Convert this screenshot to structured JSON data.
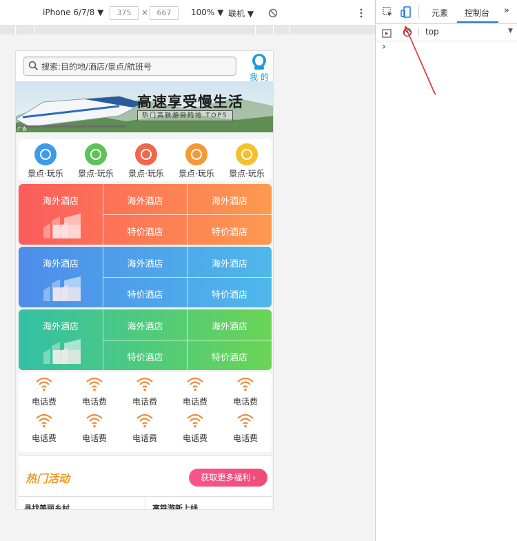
{
  "device_toolbar": {
    "device": "iPhone 6/7/8 ▼",
    "width": "375",
    "times": "×",
    "height": "667",
    "zoom": "100% ▼",
    "network": "联机 ▼"
  },
  "devtools": {
    "tabs": [
      "元素",
      "控制台"
    ],
    "active_tab": "控制台",
    "context": "top",
    "prompt": "›",
    "more": "»"
  },
  "search": {
    "placeholder": "搜索:目的地/酒店/景点/航班号",
    "my_label": "我 的"
  },
  "banner": {
    "title": "高速享受慢生活",
    "subtitle": "热门高铁游目的地 TOP5",
    "ad": "广告"
  },
  "icons": [
    {
      "label": "景点·玩乐",
      "color": "#3d9be9",
      "icon": "temple-icon"
    },
    {
      "label": "景点·玩乐",
      "color": "#5cc456",
      "icon": "mountain-icon"
    },
    {
      "label": "景点·玩乐",
      "color": "#f0674b",
      "icon": "circle-icon"
    },
    {
      "label": "景点·玩乐",
      "color": "#f29a35",
      "icon": "ferris-wheel-icon"
    },
    {
      "label": "景点·玩乐",
      "color": "#f5c030",
      "icon": "location-icon"
    }
  ],
  "hotel_blocks": [
    {
      "main": "海外酒店",
      "top1": "海外酒店",
      "top2": "海外酒店",
      "bottom1": "特价酒店",
      "bottom2": "特价酒店",
      "color_from": "#fb5c5c",
      "color_to": "#fd9a4f"
    },
    {
      "main": "海外酒店",
      "top1": "海外酒店",
      "top2": "海外酒店",
      "bottom1": "特价酒店",
      "bottom2": "特价酒店",
      "color_from": "#4e8dea",
      "color_to": "#4eb8ea"
    },
    {
      "main": "海外酒店",
      "top1": "海外酒店",
      "top2": "海外酒店",
      "bottom1": "特价酒店",
      "bottom2": "特价酒店",
      "color_from": "#34c0a5",
      "color_to": "#6ad455"
    }
  ],
  "phone_items": [
    "电话费",
    "电话费",
    "电话费",
    "电话费",
    "电话费",
    "电话费",
    "电话费",
    "电话费",
    "电话费",
    "电话费"
  ],
  "activity": {
    "title": "热门活动",
    "more_button": "获取更多福利"
  },
  "news": [
    "寻找美丽乡村",
    "高铁游新上线"
  ],
  "colors": {
    "accent": "#1a73e8",
    "wifi": "#f08a3c"
  }
}
